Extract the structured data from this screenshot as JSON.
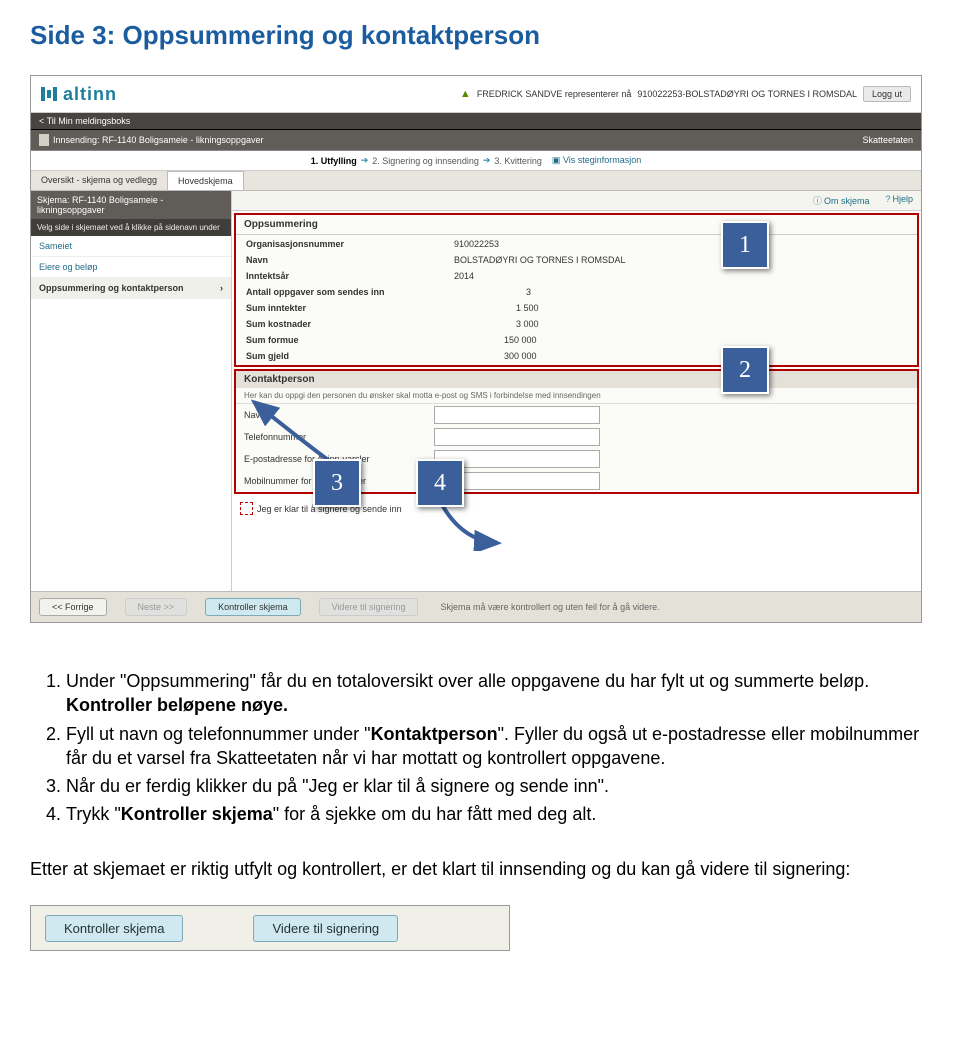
{
  "page_title": "Side 3: Oppsummering og kontaktperson",
  "altinn": {
    "brand": "altinn",
    "user_prefix": "FREDRICK SANDVE representerer nå",
    "user_org": "910022253-BOLSTADØYRI OG TORNES I ROMSDAL",
    "logout": "Logg ut",
    "back_link": "< Til Min meldingsboks",
    "session": "Innsending: RF-1140 Boligsameie - likningsoppgaver",
    "authority": "Skatteetaten",
    "steps": {
      "s1": "1. Utfylling",
      "s2": "2. Signering og innsending",
      "s3": "3. Kvittering",
      "info": "Vis steginformasjon"
    },
    "tabs": {
      "overview": "Oversikt - skjema og vedlegg",
      "main": "Hovedskjema"
    },
    "sidebar": {
      "title": "Skjema: RF-1140 Boligsameie - likningsoppgaver",
      "desc": "Velg side i skjemaet ved å klikke på sidenavn under",
      "items": [
        "Sameiet",
        "Eiere og beløp",
        "Oppsummering og kontaktperson"
      ]
    },
    "info_links": {
      "about": "Om skjema",
      "help": "Hjelp"
    },
    "summary": {
      "title": "Oppsummering",
      "rows": [
        {
          "label": "Organisasjonsnummer",
          "value": "910022253"
        },
        {
          "label": "Navn",
          "value": "BOLSTADØYRI OG TORNES I ROMSDAL"
        },
        {
          "label": "Inntektsår",
          "value": "2014"
        },
        {
          "label": "Antall oppgaver som sendes inn",
          "value": "3"
        },
        {
          "label": "Sum inntekter",
          "value": "1 500"
        },
        {
          "label": "Sum kostnader",
          "value": "3 000"
        },
        {
          "label": "Sum formue",
          "value": "150 000"
        },
        {
          "label": "Sum gjeld",
          "value": "300 000"
        }
      ]
    },
    "contact": {
      "title": "Kontaktperson",
      "note": "Her kan du oppgi den personen du ønsker skal motta e-post og SMS i forbindelse med innsendingen",
      "fields": [
        "Navn",
        "Telefonnummer",
        "E-postadresse for Altinn-varsler",
        "Mobilnummer for Altinn-varsler"
      ]
    },
    "ready_label": "Jeg er klar til å signere og sende inn",
    "bottom": {
      "prev": "<< Forrige",
      "next": "Neste >>",
      "check": "Kontroller skjema",
      "forward": "Videre til signering",
      "note": "Skjema må være kontrollert og uten feil for å gå videre."
    }
  },
  "callouts": {
    "c1": "1",
    "c2": "2",
    "c3": "3",
    "c4": "4"
  },
  "explain": {
    "i1a": "Under \"Oppsummering\" får du en totaloversikt over alle oppgavene du har fylt ut og summerte beløp. ",
    "i1b": "Kontroller beløpene nøye.",
    "i2a": "Fyll ut navn og telefonnummer under \"",
    "i2b": "Kontaktperson",
    "i2c": "\". Fyller du også ut e-postadresse eller mobilnummer får du et varsel fra Skatteetaten når vi har mottatt og kontrollert oppgavene.",
    "i3": "Når du er ferdig klikker du på \"Jeg er klar til å signere og sende inn\".",
    "i4a": "Trykk \"",
    "i4b": "Kontroller skjema",
    "i4c": "\" for å sjekke om du har fått med deg alt."
  },
  "post_text": "Etter at skjemaet er riktig utfylt og kontrollert, er det klart til innsending og du kan gå videre til signering:",
  "footer_buttons": {
    "b1": "Kontroller skjema",
    "b2": "Videre til signering"
  }
}
